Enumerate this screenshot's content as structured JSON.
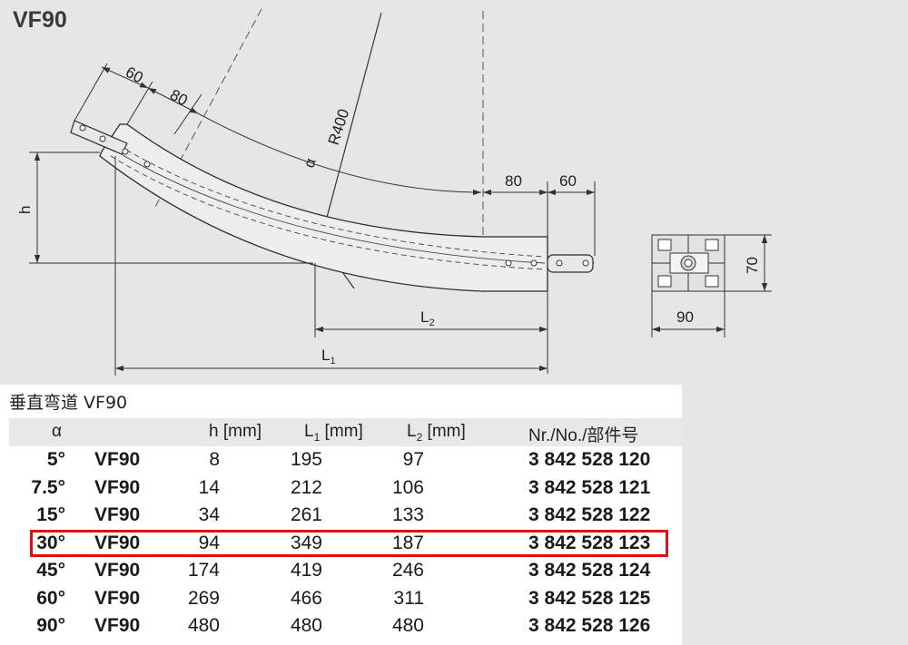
{
  "title": "VF90",
  "drawing": {
    "dim_60_top": "60",
    "dim_80_top": "80",
    "alpha": "α",
    "radius": "R400",
    "dim_80_right": "80",
    "dim_60_right": "60",
    "h": "h",
    "l2": "L",
    "l2_sub": "2",
    "l1": "L",
    "l1_sub": "1",
    "profile_height": "70",
    "profile_width": "90"
  },
  "table": {
    "caption": "垂直弯道 VF90",
    "headers": {
      "alpha": "α",
      "h": "h [mm]",
      "l1_main": "L",
      "l1_sub": "1",
      "l1_unit": " [mm]",
      "l2_main": "L",
      "l2_sub": "2",
      "l2_unit": " [mm]",
      "nr": "Nr./No./部件号"
    },
    "rows": [
      {
        "angle": "5°",
        "model": "VF90",
        "h": "8",
        "l1": "195",
        "l2": "97",
        "nr": "3 842 528 120"
      },
      {
        "angle": "7.5°",
        "model": "VF90",
        "h": "14",
        "l1": "212",
        "l2": "106",
        "nr": "3 842 528 121"
      },
      {
        "angle": "15°",
        "model": "VF90",
        "h": "34",
        "l1": "261",
        "l2": "133",
        "nr": "3 842 528 122"
      },
      {
        "angle": "30°",
        "model": "VF90",
        "h": "94",
        "l1": "349",
        "l2": "187",
        "nr": "3 842 528 123"
      },
      {
        "angle": "45°",
        "model": "VF90",
        "h": "174",
        "l1": "419",
        "l2": "246",
        "nr": "3 842 528 124"
      },
      {
        "angle": "60°",
        "model": "VF90",
        "h": "269",
        "l1": "466",
        "l2": "311",
        "nr": "3 842 528 125"
      },
      {
        "angle": "90°",
        "model": "VF90",
        "h": "480",
        "l1": "480",
        "l2": "480",
        "nr": "3 842 528 126"
      }
    ],
    "highlight_color": "#e01010"
  }
}
